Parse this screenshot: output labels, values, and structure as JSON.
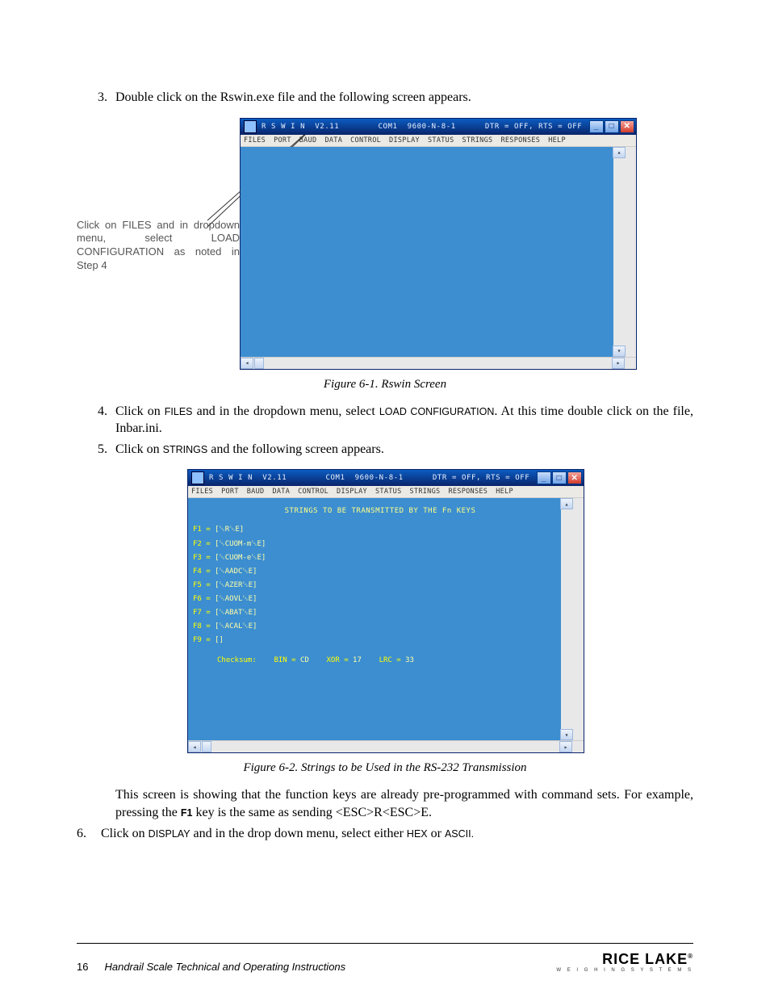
{
  "steps": {
    "s3": {
      "num": "3.",
      "text_a": "Double click on the Rswin.exe file and the following screen appears."
    },
    "s4": {
      "num": "4.",
      "text_a": "Click on ",
      "m1": "FILES",
      "text_b": " and in the dropdown menu, select ",
      "m2": "LOAD CONFIGURATION",
      "text_c": ". At this time double click on the file, Inbar.ini."
    },
    "s5": {
      "num": "5.",
      "text_a": "Click on ",
      "m1": "STRINGS",
      "text_b": " and the following screen appears."
    },
    "s6": {
      "num": "6.",
      "text_a": "Click on ",
      "m1": "DISPLAY",
      "text_b": " and in the drop down menu, select either ",
      "m2": "HEX",
      "text_c": " or ",
      "m3": "ASCII."
    }
  },
  "annotation": "Click on FILES and in dropdown menu, select LOAD CONFIGURATION as noted in Step 4",
  "win": {
    "title_a": "R S W I N  V2.11",
    "title_b": "COM1  9600-N-8-1",
    "title_c": "DTR = OFF, RTS = OFF",
    "menus": [
      "FILES",
      "PORT",
      "BAUD",
      "DATA",
      "CONTROL",
      "DISPLAY",
      "STATUS",
      "STRINGS",
      "RESPONSES",
      "HELP"
    ]
  },
  "fig2": {
    "header": "STRINGS TO BE TRANSMITTED BY THE Fn KEYS",
    "rows": [
      {
        "k": "F1 =",
        "v": "[␛R␛E]"
      },
      {
        "k": "F2 =",
        "v": "[␛CUOM-m␛E]"
      },
      {
        "k": "F3 =",
        "v": "[␛CUOM-e␛E]"
      },
      {
        "k": "F4 =",
        "v": "[␛AADC␛E]"
      },
      {
        "k": "F5 =",
        "v": "[␛AZER␛E]"
      },
      {
        "k": "F6 =",
        "v": "[␛AOVL␛E]"
      },
      {
        "k": "F7 =",
        "v": "[␛ABAT␛E]"
      },
      {
        "k": "F8 =",
        "v": "[␛ACAL␛E]"
      },
      {
        "k": "F9 =",
        "v": "[]"
      }
    ],
    "checksum": {
      "label": "Checksum:",
      "bin_l": "BIN =",
      "bin_v": "CD",
      "xor_l": "XOR =",
      "xor_v": "17",
      "lrc_l": "LRC =",
      "lrc_v": "33"
    }
  },
  "captions": {
    "c1": "Figure 6-1. Rswin Screen",
    "c2": "Figure 6-2. Strings to be Used in the RS-232 Transmission"
  },
  "para": {
    "a": "This screen is showing that the function keys are already pre-programmed with command sets. For example, pressing the ",
    "key": "F1",
    "b": " key is the same as sending <ESC>R<ESC>E."
  },
  "footer": {
    "page": "16",
    "book": "Handrail Scale Technical and Operating Instructions",
    "logo_big": "RICE LAKE",
    "logo_sm": "W E I G H I N G   S Y S T E M S"
  }
}
